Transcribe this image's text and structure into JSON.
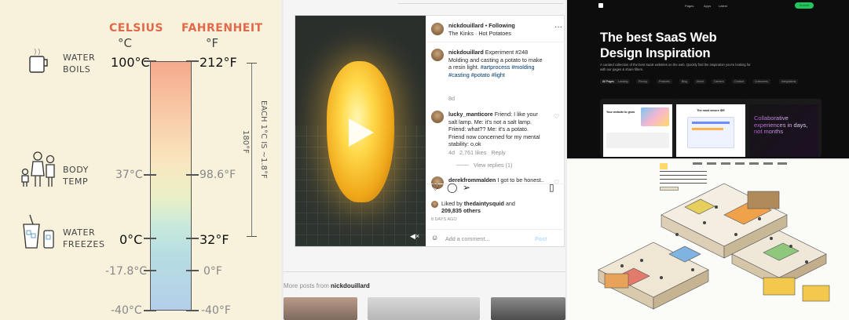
{
  "thermometer": {
    "celsius_header": "CELSIUS",
    "celsius_unit": "°C",
    "fahrenheit_header": "FAHRENHEIT",
    "fahrenheit_unit": "°F",
    "rows": [
      {
        "label_line1": "WATER",
        "label_line2": "BOILS",
        "celsius": "100°C",
        "fahrenheit": "212°F"
      },
      {
        "label_line1": "BODY",
        "label_line2": "TEMP",
        "celsius": "37°C",
        "fahrenheit": "98.6°F"
      },
      {
        "label_line1": "WATER",
        "label_line2": "FREEZES",
        "celsius": "0°C",
        "fahrenheit": "32°F"
      }
    ],
    "extra_celsius": [
      "-17.8°C",
      "-40°C"
    ],
    "extra_fahrenheit": [
      "0°F",
      "-40°F"
    ],
    "span_label": "180°F",
    "each_label": "EACH 1°C IS ~1.8°F"
  },
  "instagram": {
    "username": "nickdouillard",
    "following": "Following",
    "audio": "The Kinks · Hot Potatoes",
    "caption_text": "Experiment #248 Molding and casting a potato to make a resin light.",
    "caption_tags": "#artprocess #molding #casting #potato #light",
    "caption_age": "8d",
    "comment1": {
      "user": "lucky_manticore",
      "text": "Friend: I like your salt lamp. Me: it's not a salt lamp. Friend: what?? Me: it's a potato. Friend now concerned for my mental stability: o,ok",
      "age": "4d",
      "likes": "2,761 likes",
      "reply": "Reply",
      "view_replies": "View replies (1)"
    },
    "comment2": {
      "user": "derekfrommalden",
      "text": "I got to be honest.. I was thinking could they"
    },
    "liked_by_prefix": "Liked by",
    "liked_by_user": "thedaintysquid",
    "liked_by_and": "and",
    "likes_total": "209,835 others",
    "post_age": "8 DAYS AGO",
    "add_comment_placeholder": "Add a comment...",
    "post_button": "Post",
    "more_from": "nickdouillard",
    "more_prefix": "More posts from"
  },
  "saas": {
    "nav_items": [
      "Pages",
      "Apps",
      "Latest"
    ],
    "nav_cta": "Submit",
    "headline_line1": "The best SaaS Web",
    "headline_line2": "Design Inspiration",
    "description": "A curated collection of the best SaaS websites on the web. Quickly find the inspiration you're looking for with our pages & share filters.",
    "filters": [
      "All Pages",
      "Landing",
      "Pricing",
      "Features",
      "Blog",
      "About",
      "Careers",
      "Contact",
      "Customers",
      "Integrations"
    ],
    "cards": [
      {
        "headline": "Your website to grow"
      },
      {
        "headline": "The most secure IDE"
      },
      {
        "headline": "Collaborative experiences in days, not months"
      }
    ]
  },
  "colors": {
    "celsius_accent": "#e1694a",
    "instagram_link": "#00376b",
    "instagram_post_button": "#b2dffc",
    "saas_cta": "#22c55e",
    "card3_gradient_start": "#b15bd8"
  }
}
